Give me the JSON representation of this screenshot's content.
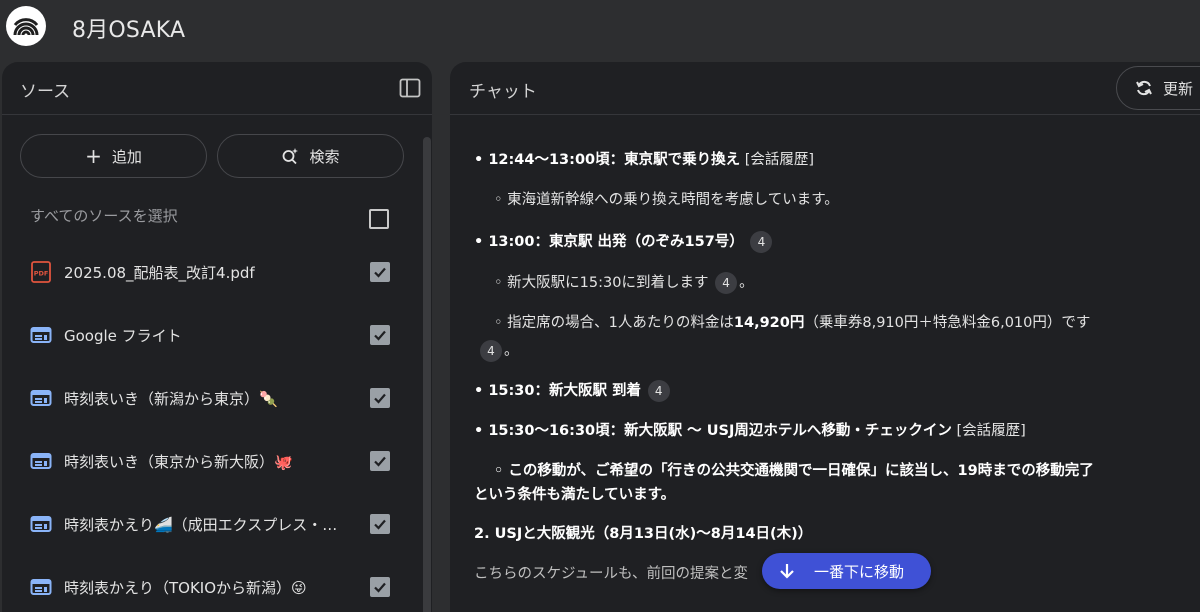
{
  "app": {
    "title": "8月OSAKA",
    "logo_icon": "notebook-logo-icon"
  },
  "sources_panel": {
    "title": "ソース",
    "add_label": "追加",
    "search_label": "検索",
    "select_all_label": "すべてのソースを選択",
    "items": [
      {
        "label": "2025.08_配船表_改訂4.pdf",
        "icon": "pdf-icon",
        "checked": true
      },
      {
        "label": "Google フライト",
        "icon": "web-source-icon",
        "checked": true
      },
      {
        "label": "時刻表いき（新潟から東京）🍡",
        "icon": "web-source-icon",
        "checked": true
      },
      {
        "label": "時刻表いき（東京から新大阪）🐙",
        "icon": "web-source-icon",
        "checked": true
      },
      {
        "label": "時刻表かえり🚄（成田エクスプレス・…",
        "icon": "web-source-icon",
        "checked": true
      },
      {
        "label": "時刻表かえり（TOKIOから新潟）😜",
        "icon": "web-source-icon",
        "checked": true
      }
    ]
  },
  "chat_panel": {
    "title": "チャット",
    "refresh_label": "更新",
    "jump_label": "一番下に移動",
    "lines": {
      "l1_bold": "• 12:44〜13:00頃：東京駅で乗り換え",
      "l1_tail": " [会話履歴]",
      "l2": "◦ 東海道新幹線への乗り換え時間を考慮しています。",
      "l3_bold": "• 13:00：東京駅 出発（のぞみ157号）",
      "l3_cite": "4",
      "l4": "◦ 新大阪駅に15:30に到着します",
      "l4_cite": "4",
      "l4_tail": "。",
      "l5_a": "◦ 指定席の場合、1人あたりの料金は",
      "l5_bold": "14,920円",
      "l5_b": "（乗車券8,910円＋特急料金6,010円）です",
      "l6_cite": "4",
      "l6_tail": "。",
      "l7_bold": "• 15:30：新大阪駅 到着",
      "l7_cite": "4",
      "l8_bold": "• 15:30〜16:30頃：新大阪駅 〜 USJ周辺ホテルへ移動・チェックイン",
      "l8_tail": " [会話履歴]",
      "l9_bold": "◦ この移動が、ご希望の「行きの公共交通機関で一日確保」に該当し、19時までの移動完了",
      "l10_bold": "という条件も満たしています。",
      "l11_bold": "2. USJと大阪観光（8月13日(水)〜8月14日(木)）",
      "l12": "こちらのスケジュールも、前回の提案と変"
    }
  },
  "colors": {
    "background": "#2d2e30",
    "panel": "#1f2023",
    "accent_button": "#3f51d6"
  }
}
